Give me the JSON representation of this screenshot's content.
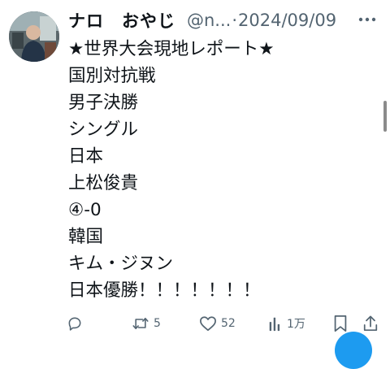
{
  "tweet": {
    "author": {
      "display_name": "ナロ　おやじ",
      "handle": "@n...",
      "separator": "·",
      "date": "2024/09/09"
    },
    "lines": [
      "★世界大会現地レポート★",
      "国別対抗戦",
      "男子決勝",
      "シングル",
      "日本",
      "上松俊貴",
      "④-0",
      "韓国",
      "キム・ジヌン",
      "日本優勝！！！！！！！"
    ],
    "actions": {
      "reply_icon": "reply-icon",
      "retweet_icon": "retweet-icon",
      "retweet_count": "5",
      "like_icon": "like-icon",
      "like_count": "52",
      "views_icon": "views-icon",
      "views_count": "1万",
      "bookmark_icon": "bookmark-icon",
      "share_icon": "share-icon"
    },
    "more_icon": "more-icon"
  },
  "colors": {
    "text": "#0f1419",
    "secondary": "#536471",
    "accent": "#1d9bf0"
  }
}
